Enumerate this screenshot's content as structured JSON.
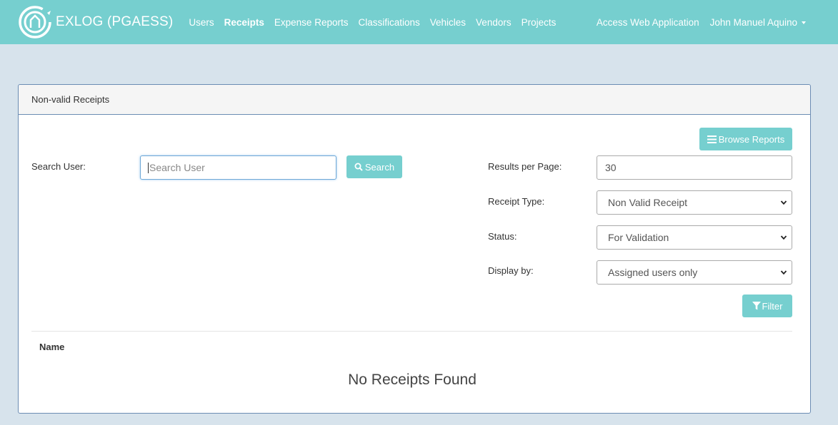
{
  "brand": {
    "name": "EXLOG (PGAESS)"
  },
  "nav": {
    "links": [
      {
        "label": "Users",
        "active": false
      },
      {
        "label": "Receipts",
        "active": true
      },
      {
        "label": "Expense Reports",
        "active": false
      },
      {
        "label": "Classifications",
        "active": false
      },
      {
        "label": "Vehicles",
        "active": false
      },
      {
        "label": "Vendors",
        "active": false
      },
      {
        "label": "Projects",
        "active": false
      }
    ],
    "access_web_app": "Access Web Application",
    "user_name": "John Manuel Aquino"
  },
  "panel": {
    "title": "Non-valid Receipts",
    "browse_reports_label": "Browse Reports",
    "search_user_label": "Search User:",
    "search_user_placeholder": "Search User",
    "search_button_label": "Search",
    "results_per_page_label": "Results per Page:",
    "results_per_page_value": "30",
    "receipt_type_label": "Receipt Type:",
    "receipt_type_value": "Non Valid Receipt",
    "status_label": "Status:",
    "status_value": "For Validation",
    "display_by_label": "Display by:",
    "display_by_value": "Assigned users only",
    "filter_button_label": "Filter",
    "table_column_name": "Name",
    "empty_message": "No Receipts Found"
  },
  "colors": {
    "navbar": "#76cfcf",
    "page_background": "#d7e3ec",
    "button": "#76cfcf",
    "panel_border": "#6b8cb3"
  }
}
